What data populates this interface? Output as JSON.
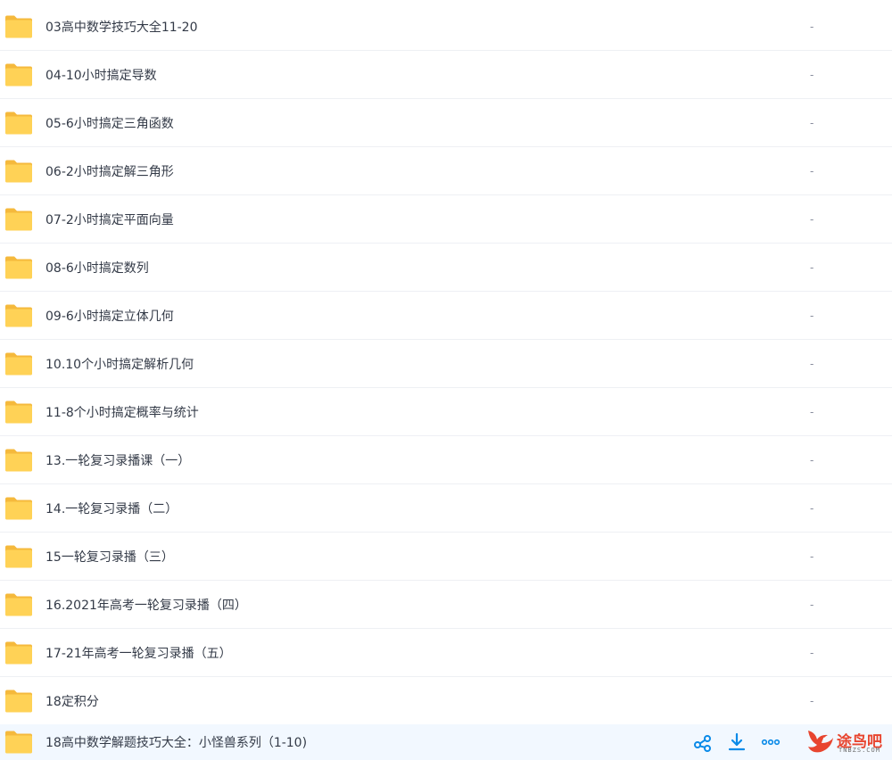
{
  "file_list": {
    "rows": [
      {
        "name": "03高中数学技巧大全11-20",
        "size": "-"
      },
      {
        "name": "04-10小时搞定导数",
        "size": "-"
      },
      {
        "name": "05-6小时搞定三角函数",
        "size": "-"
      },
      {
        "name": "06-2小时搞定解三角形",
        "size": "-"
      },
      {
        "name": "07-2小时搞定平面向量",
        "size": "-"
      },
      {
        "name": "08-6小时搞定数列",
        "size": "-"
      },
      {
        "name": "09-6小时搞定立体几何",
        "size": "-"
      },
      {
        "name": "10.10个小时搞定解析几何",
        "size": "-"
      },
      {
        "name": "11-8个小时搞定概率与统计",
        "size": "-"
      },
      {
        "name": "13.一轮复习录播课（一）",
        "size": "-"
      },
      {
        "name": "14.一轮复习录播（二）",
        "size": "-"
      },
      {
        "name": "15一轮复习录播（三）",
        "size": "-"
      },
      {
        "name": "16.2021年高考一轮复习录播（四）",
        "size": "-"
      },
      {
        "name": "17-21年高考一轮复习录播（五）",
        "size": "-"
      },
      {
        "name": "18定积分",
        "size": "-"
      },
      {
        "name": "18高中数学解题技巧大全：小怪兽系列（1-10)",
        "size": ""
      }
    ],
    "hovered_row_actions": {
      "share_icon": "share-icon",
      "download_icon": "download-icon",
      "more_icon": "more-icon"
    }
  },
  "watermark": {
    "text": "途鸟吧",
    "subtext": "TNBZS.COM"
  },
  "colors": {
    "folder": "#ffd256",
    "folder_back": "#f5b93c",
    "action_icon": "#0a8ae8",
    "hover_row": "#f2f8ff",
    "text": "#333a47",
    "watermark": "#e8452f"
  }
}
